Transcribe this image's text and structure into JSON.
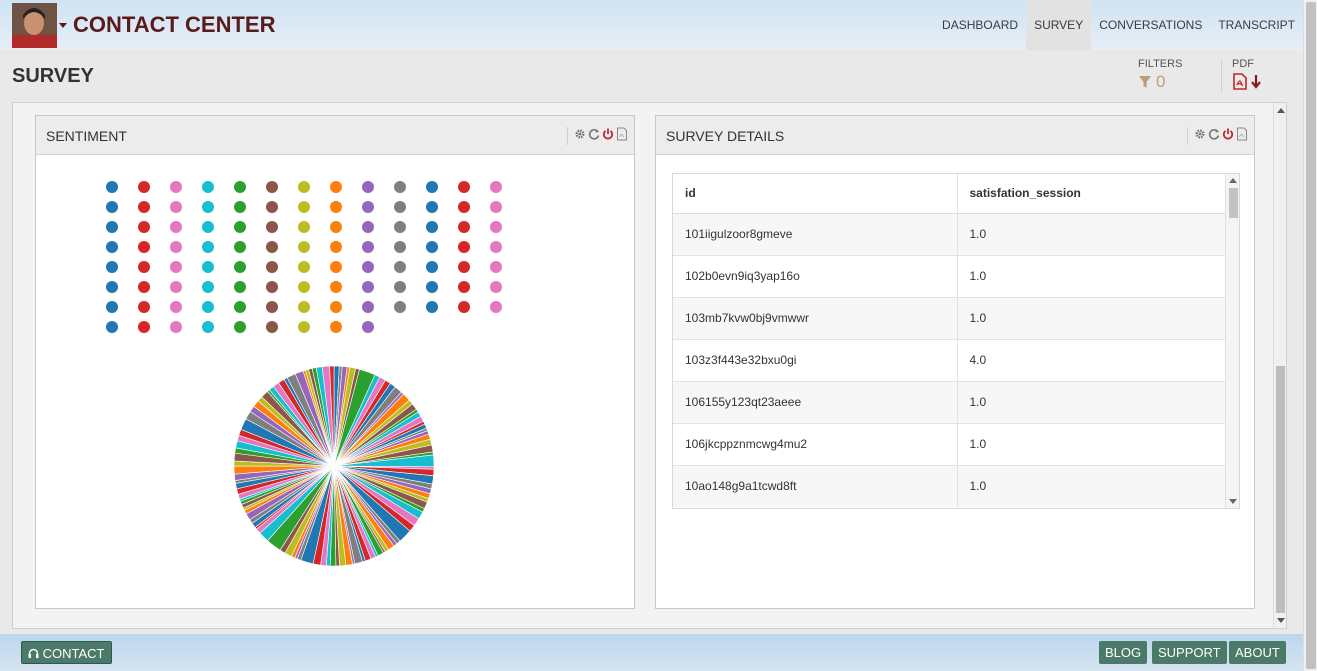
{
  "header": {
    "brand": "CONTACT CENTER",
    "nav": [
      "DASHBOARD",
      "SURVEY",
      "CONVERSATIONS",
      "TRANSCRIPT"
    ],
    "active_nav": "SURVEY"
  },
  "page": {
    "title": "SURVEY",
    "filters_label": "FILTERS",
    "filters_count": "0",
    "pdf_label": "PDF"
  },
  "sentiment_panel": {
    "title": "SENTIMENT"
  },
  "survey_panel": {
    "title": "SURVEY DETAILS",
    "columns": [
      "id",
      "satisfation_session"
    ],
    "rows": [
      [
        "101iigulzoor8gmeve",
        "1.0"
      ],
      [
        "102b0evn9iq3yap16o",
        "1.0"
      ],
      [
        "103mb7kvw0bj9vmwwr",
        "1.0"
      ],
      [
        "103z3f443e32bxu0gi",
        "4.0"
      ],
      [
        "106155y123qt23aeee",
        "1.0"
      ],
      [
        "106jkcppznmcwg4mu2",
        "1.0"
      ],
      [
        "10ao148g9a1tcwd8ft",
        "1.0"
      ]
    ]
  },
  "footer": {
    "contact": "CONTACT",
    "blog": "BLOG",
    "support": "SUPPORT",
    "about": "ABOUT"
  },
  "colors": {
    "palette": [
      "#1f77b4",
      "#ff7f0e",
      "#2ca02c",
      "#d62728",
      "#9467bd",
      "#8c564b",
      "#e377c2",
      "#7f7f7f",
      "#bcbd22",
      "#17becf"
    ],
    "brand": "#5a1b1b",
    "filter_accent": "#b9a070",
    "button": "#4b7a6a"
  }
}
